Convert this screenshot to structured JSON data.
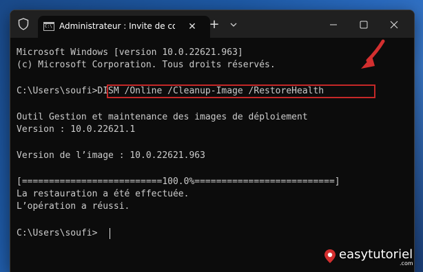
{
  "titlebar": {
    "tab_title": "Administrateur : Invite de con",
    "close_glyph": "✕",
    "new_tab_glyph": "+"
  },
  "console": {
    "lines": [
      "Microsoft Windows [version 10.0.22621.963]",
      "(c) Microsoft Corporation. Tous droits réservés.",
      "",
      "C:\\Users\\soufi>DISM /Online /Cleanup-Image /RestoreHealth",
      "",
      "Outil Gestion et maintenance des images de déploiement",
      "Version : 10.0.22621.1",
      "",
      "Version de l’image : 10.0.22621.963",
      "",
      "[==========================100.0%==========================]",
      "La restauration a été effectuée.",
      "L’opération a réussi.",
      "",
      "C:\\Users\\soufi>"
    ]
  },
  "watermark": {
    "brand": "easytutoriel",
    "domain": ".com"
  },
  "colors": {
    "highlight": "#c62828",
    "arrow": "#d32f2f",
    "console_bg": "#0c0c0c",
    "console_text": "#cccccc"
  }
}
